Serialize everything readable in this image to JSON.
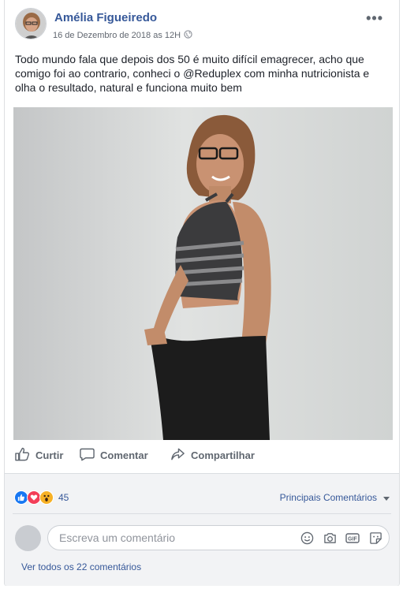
{
  "post": {
    "author": "Amélia Figueiredo",
    "date": "16 de Dezembro de 2018 as 12H",
    "text": "Todo mundo fala que depois dos 50 é muito difícil emagrecer, acho que comigo foi ao contrario, conheci o @Reduplex   com minha nutricionista e olha o resultado, natural e funciona muito bem"
  },
  "actions": {
    "like": "Curtir",
    "comment": "Comentar",
    "share": "Compartilhar"
  },
  "reactions": {
    "count": "45",
    "icons": [
      "like-icon",
      "love-icon",
      "wow-icon"
    ]
  },
  "filter": {
    "label": "Principais Comentários"
  },
  "comment_input": {
    "placeholder": "Escreva um comentário"
  },
  "view_all": "Ver todos os 22 comentários",
  "colors": {
    "link": "#365899",
    "like": "#1877f2",
    "love": "#f33e58",
    "wow": "#f7b125"
  }
}
